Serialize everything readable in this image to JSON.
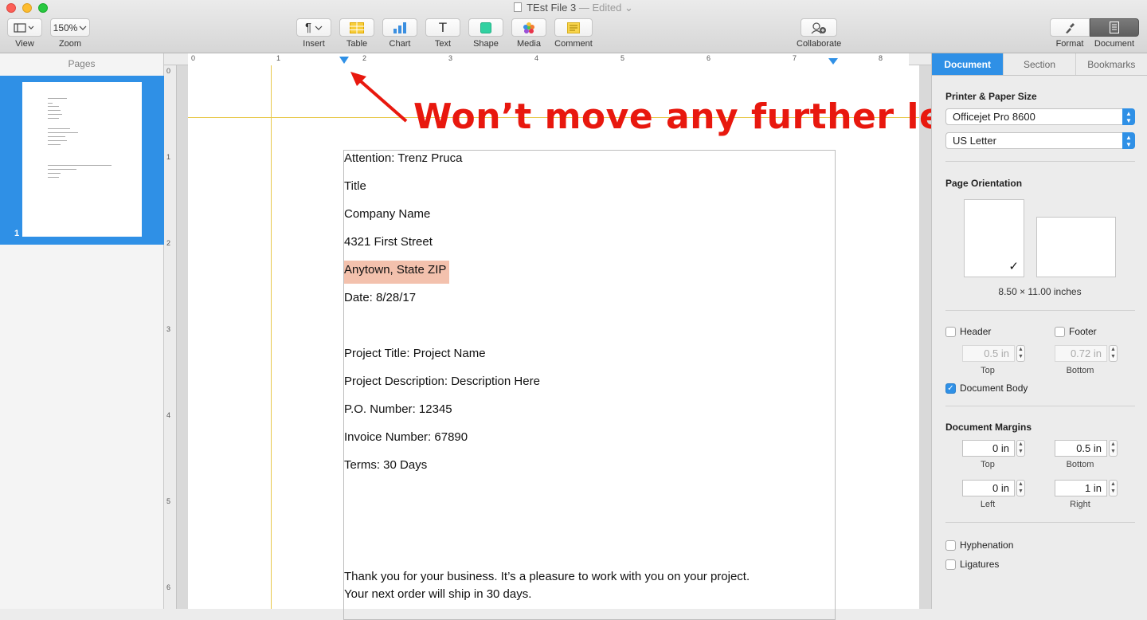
{
  "window": {
    "title": "TEst File 3",
    "status": "— Edited",
    "status_chevron": "⌄"
  },
  "toolbar": {
    "view": {
      "label": "View",
      "icon": "sidebar-icon"
    },
    "zoom": {
      "label": "Zoom",
      "value": "150%"
    },
    "insert": {
      "label": "Insert",
      "icon": "pilcrow-icon",
      "glyph": "¶"
    },
    "table": {
      "label": "Table"
    },
    "chart": {
      "label": "Chart"
    },
    "text": {
      "label": "Text",
      "glyph": "T"
    },
    "shape": {
      "label": "Shape"
    },
    "media": {
      "label": "Media"
    },
    "comment": {
      "label": "Comment"
    },
    "collaborate": {
      "label": "Collaborate"
    },
    "format": {
      "label": "Format"
    },
    "document": {
      "label": "Document"
    }
  },
  "pages_panel": {
    "header": "Pages",
    "page_number": "1"
  },
  "ruler": {
    "h_numbers": [
      "0",
      "1",
      "2",
      "3",
      "4",
      "5",
      "6",
      "7",
      "8"
    ],
    "v_numbers": [
      "0",
      "1",
      "2",
      "3",
      "4",
      "5",
      "6"
    ]
  },
  "annotation": {
    "text": "Won’t move any further left",
    "color": "#e8180e"
  },
  "document": {
    "lines": [
      "Attention: Trenz Pruca",
      "Title",
      "Company Name",
      "4321 First Street",
      "Anytown, State ZIP",
      "Date: 8/28/17",
      "Project Title: Project Name",
      "Project Description: Description Here",
      "P.O. Number: 12345",
      "Invoice Number: 67890",
      "Terms: 30 Days",
      "Thank you for your business. It’s a pleasure to work with you on your project.",
      "Your next order will ship in 30 days."
    ],
    "highlight_color": "#f3c1ad"
  },
  "inspector": {
    "tabs": [
      "Document",
      "Section",
      "Bookmarks"
    ],
    "active_tab": "Document",
    "printer_paper": {
      "title": "Printer & Paper Size",
      "printer": "Officejet Pro 8600",
      "paper": "US Letter"
    },
    "orientation": {
      "title": "Page Orientation",
      "size_caption": "8.50 × 11.00 inches",
      "check": "✓"
    },
    "header_footer": {
      "header_label": "Header",
      "header_checked": false,
      "footer_label": "Footer",
      "footer_checked": false,
      "top_value": "0.5 in",
      "top_caption": "Top",
      "bottom_value": "0.72 in",
      "bottom_caption": "Bottom",
      "body_label": "Document Body",
      "body_checked": true
    },
    "margins": {
      "title": "Document Margins",
      "top": "0 in",
      "top_caption": "Top",
      "bottom": "0.5 in",
      "bottom_caption": "Bottom",
      "left": "0 in",
      "left_caption": "Left",
      "right": "1 in",
      "right_caption": "Right"
    },
    "hyphenation_label": "Hyphenation",
    "ligatures_label": "Ligatures"
  },
  "colors": {
    "accent": "#2f90e6",
    "guide": "#e8c84a"
  }
}
